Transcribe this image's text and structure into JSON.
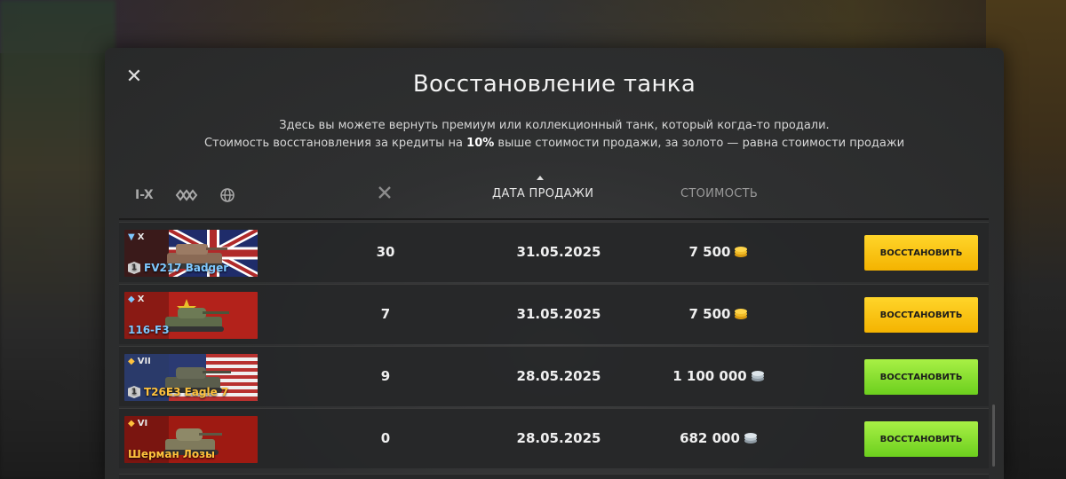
{
  "modal": {
    "title": "Восстановление танка",
    "desc_line1": "Здесь вы можете вернуть премиум или коллекционный танк, который когда-то продали.",
    "desc_line2_a": "Стоимость восстановления за кредиты на ",
    "desc_line2_bold": "10%",
    "desc_line2_b": " выше стоимости продажи, за золото — равна стоимости продажи"
  },
  "filters": {
    "tier_label": "I-X",
    "type_icon": "tank-type-filter-icon",
    "nation_icon": "globe-icon"
  },
  "columns": {
    "battles_icon": "crossed-swords-icon",
    "date": "ДАТА ПРОДАЖИ",
    "cost": "СТОИМОСТЬ"
  },
  "rows": [
    {
      "tier": "X",
      "name": "FV217 Badger",
      "name_color": "#7ec8ff",
      "collector": true,
      "flag": "uk",
      "battles": "30",
      "date": "31.05.2025",
      "cost": "7 500",
      "currency": "gold",
      "button": "ВОССТАНОВИТЬ"
    },
    {
      "tier": "X",
      "name": "116-F3",
      "name_color": "#7ec8ff",
      "collector": false,
      "flag": "china",
      "battles": "7",
      "date": "31.05.2025",
      "cost": "7 500",
      "currency": "gold",
      "button": "ВОССТАНОВИТЬ"
    },
    {
      "tier": "VII",
      "name": "T26E3 Eagle 7",
      "name_color": "#ffc23d",
      "collector": true,
      "flag": "usa",
      "battles": "9",
      "date": "28.05.2025",
      "cost": "1 100 000",
      "currency": "credits",
      "button": "ВОССТАНОВИТЬ"
    },
    {
      "tier": "VI",
      "name": "Шерман Лозы",
      "name_color": "#ffc23d",
      "collector": false,
      "flag": "ussr",
      "battles": "0",
      "date": "28.05.2025",
      "cost": "682 000",
      "currency": "credits",
      "button": "ВОССТАНОВИТЬ"
    }
  ],
  "colors": {
    "gold_button": "#f7c20a",
    "credit_button": "#86dd2e",
    "premium_name": "#ffc23d",
    "collector_name": "#7ec8ff"
  }
}
